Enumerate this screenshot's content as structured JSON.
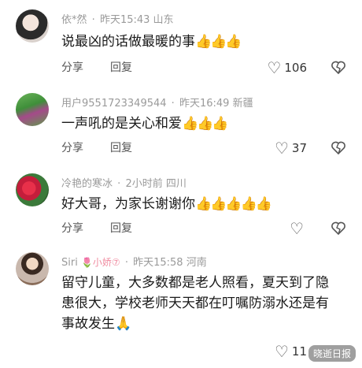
{
  "comments": [
    {
      "username": "依*然",
      "separator": "·",
      "time": "昨天15:43",
      "location": "山东",
      "text": "说最凶的话做最暖的事",
      "emoji": "👍👍👍",
      "share_label": "分享",
      "reply_label": "回复",
      "likes": "106"
    },
    {
      "username": "用户9551723349544",
      "separator": "·",
      "time": "昨天16:49",
      "location": "新疆",
      "text": "一声吼的是关心和爱",
      "emoji": "👍👍👍",
      "share_label": "分享",
      "reply_label": "回复",
      "likes": "37"
    },
    {
      "username": "冷艳的寒冰",
      "separator": "·",
      "time": "2小时前",
      "location": "四川",
      "text": "好大哥，为家长谢谢你",
      "emoji": "👍👍👍👍👍",
      "share_label": "分享",
      "reply_label": "回复",
      "likes": ""
    },
    {
      "username": "Siri",
      "badge": "🌷小娇⑦",
      "separator": "·",
      "time": "昨天15:58",
      "location": "河南",
      "text": "留守儿童，大多数都是老人照看，夏天到了隐患很大，学校老师天天都在叮嘱防溺水还是有事故发生",
      "emoji": "🙏",
      "share_label": "",
      "reply_label": "",
      "likes": "11"
    }
  ],
  "watermark": "晓逝日报"
}
